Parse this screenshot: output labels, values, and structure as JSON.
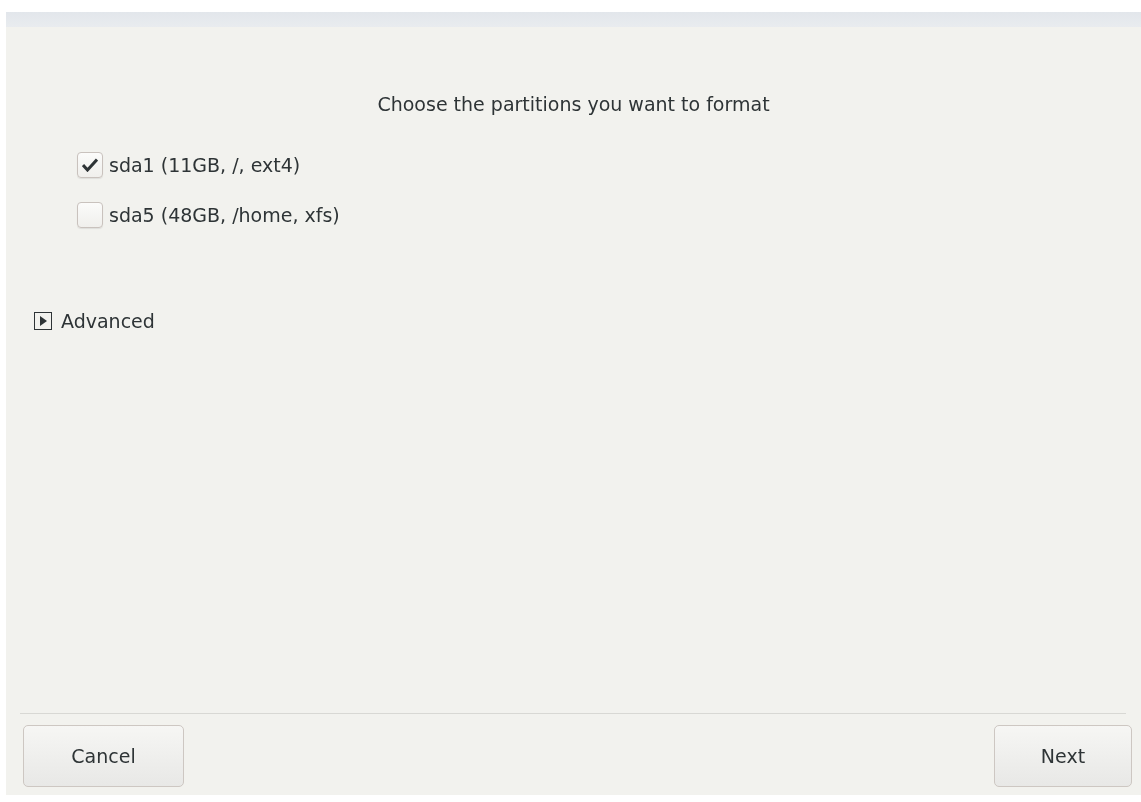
{
  "prompt": "Choose the partitions you want to format",
  "partitions": [
    {
      "label": "sda1 (11GB, /, ext4)",
      "checked": true
    },
    {
      "label": "sda5 (48GB, /home, xfs)",
      "checked": false
    }
  ],
  "advanced": {
    "label": "Advanced",
    "expanded": false
  },
  "buttons": [
    {
      "label": "Cancel",
      "kind": "cancel"
    },
    {
      "label": "Next",
      "kind": "next"
    }
  ]
}
